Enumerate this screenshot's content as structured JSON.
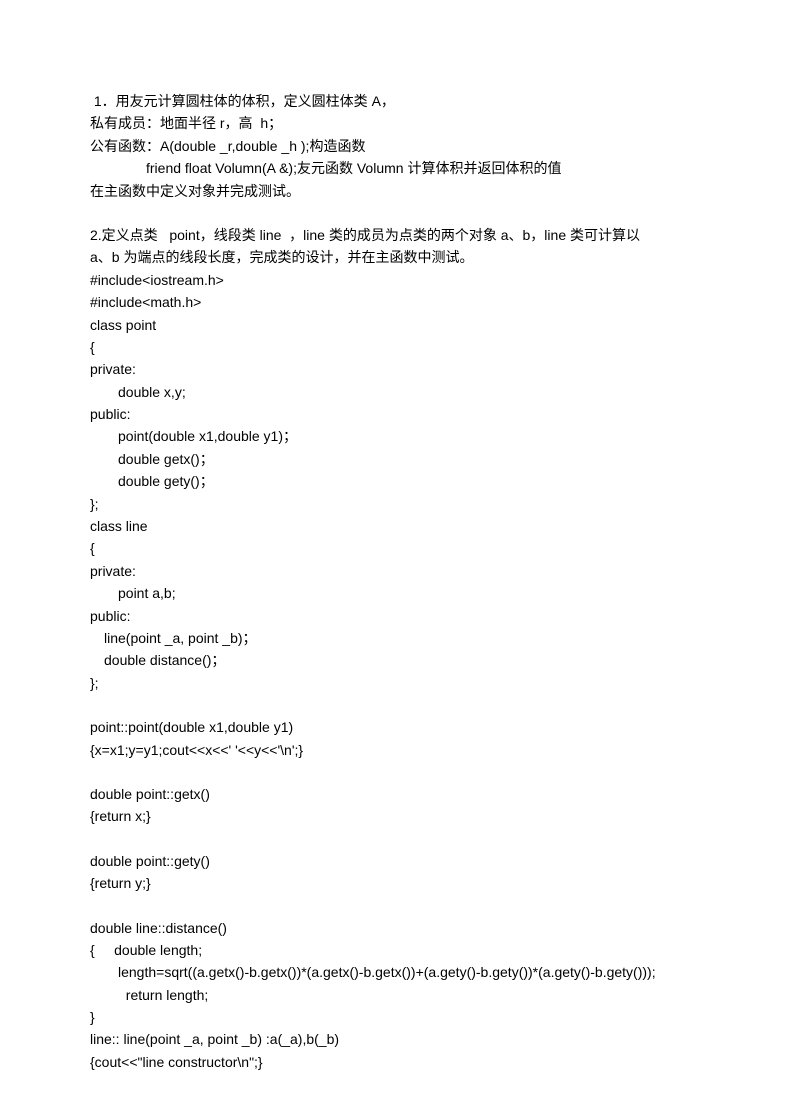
{
  "lines": [
    {
      "text": " 1．用友元计算圆柱体的体积，定义圆柱体类 A，",
      "class": ""
    },
    {
      "text": "私有成员：地面半径 r，高  h；",
      "class": ""
    },
    {
      "text": "公有函数：A(double _r,double _h );构造函数",
      "class": ""
    },
    {
      "text": "friend float Volumn(A &);友元函数 Volumn 计算体积并返回体积的值",
      "class": "indent2"
    },
    {
      "text": "在主函数中定义对象并完成测试。",
      "class": ""
    },
    {
      "text": "",
      "class": "blank"
    },
    {
      "text": "2.定义点类   point，线段类 line  ，line 类的成员为点类的两个对象 a、b，line 类可计算以",
      "class": ""
    },
    {
      "text": "a、b 为端点的线段长度，完成类的设计，并在主函数中测试。",
      "class": ""
    },
    {
      "text": "#include<iostream.h>",
      "class": ""
    },
    {
      "text": "#include<math.h>",
      "class": ""
    },
    {
      "text": "class point",
      "class": ""
    },
    {
      "text": "{",
      "class": ""
    },
    {
      "text": "private:",
      "class": ""
    },
    {
      "text": "double x,y;",
      "class": "indent1"
    },
    {
      "text": "public:",
      "class": ""
    },
    {
      "text": "point(double x1,double y1)；",
      "class": "indent1"
    },
    {
      "text": "double getx()；",
      "class": "indent1"
    },
    {
      "text": "double gety()；",
      "class": "indent1"
    },
    {
      "text": "};",
      "class": ""
    },
    {
      "text": "class line",
      "class": ""
    },
    {
      "text": "{",
      "class": ""
    },
    {
      "text": "private:",
      "class": ""
    },
    {
      "text": "point a,b;",
      "class": "indent1"
    },
    {
      "text": "public:",
      "class": ""
    },
    {
      "text": "line(point _a, point _b)；",
      "class": "indent-small"
    },
    {
      "text": "double distance()；",
      "class": "indent-small"
    },
    {
      "text": "};",
      "class": ""
    },
    {
      "text": "",
      "class": "blank"
    },
    {
      "text": "point::point(double x1,double y1)",
      "class": ""
    },
    {
      "text": "{x=x1;y=y1;cout<<x<<' '<<y<<'\\n';}",
      "class": ""
    },
    {
      "text": "",
      "class": "blank"
    },
    {
      "text": "double point::getx()",
      "class": ""
    },
    {
      "text": "{return x;}",
      "class": ""
    },
    {
      "text": "",
      "class": "blank"
    },
    {
      "text": "double point::gety()",
      "class": ""
    },
    {
      "text": "{return y;}",
      "class": ""
    },
    {
      "text": "",
      "class": "blank"
    },
    {
      "text": "double line::distance()",
      "class": ""
    },
    {
      "text": "{     double length;",
      "class": ""
    },
    {
      "text": "length=sqrt((a.getx()-b.getx())*(a.getx()-b.getx())+(a.gety()-b.gety())*(a.gety()-b.gety()));",
      "class": "indent1"
    },
    {
      "text": "  return length;",
      "class": "indent1"
    },
    {
      "text": "}",
      "class": ""
    },
    {
      "text": "line:: line(point _a, point _b) :a(_a),b(_b)",
      "class": ""
    },
    {
      "text": "{cout<<\"line constructor\\n\";}",
      "class": ""
    }
  ]
}
